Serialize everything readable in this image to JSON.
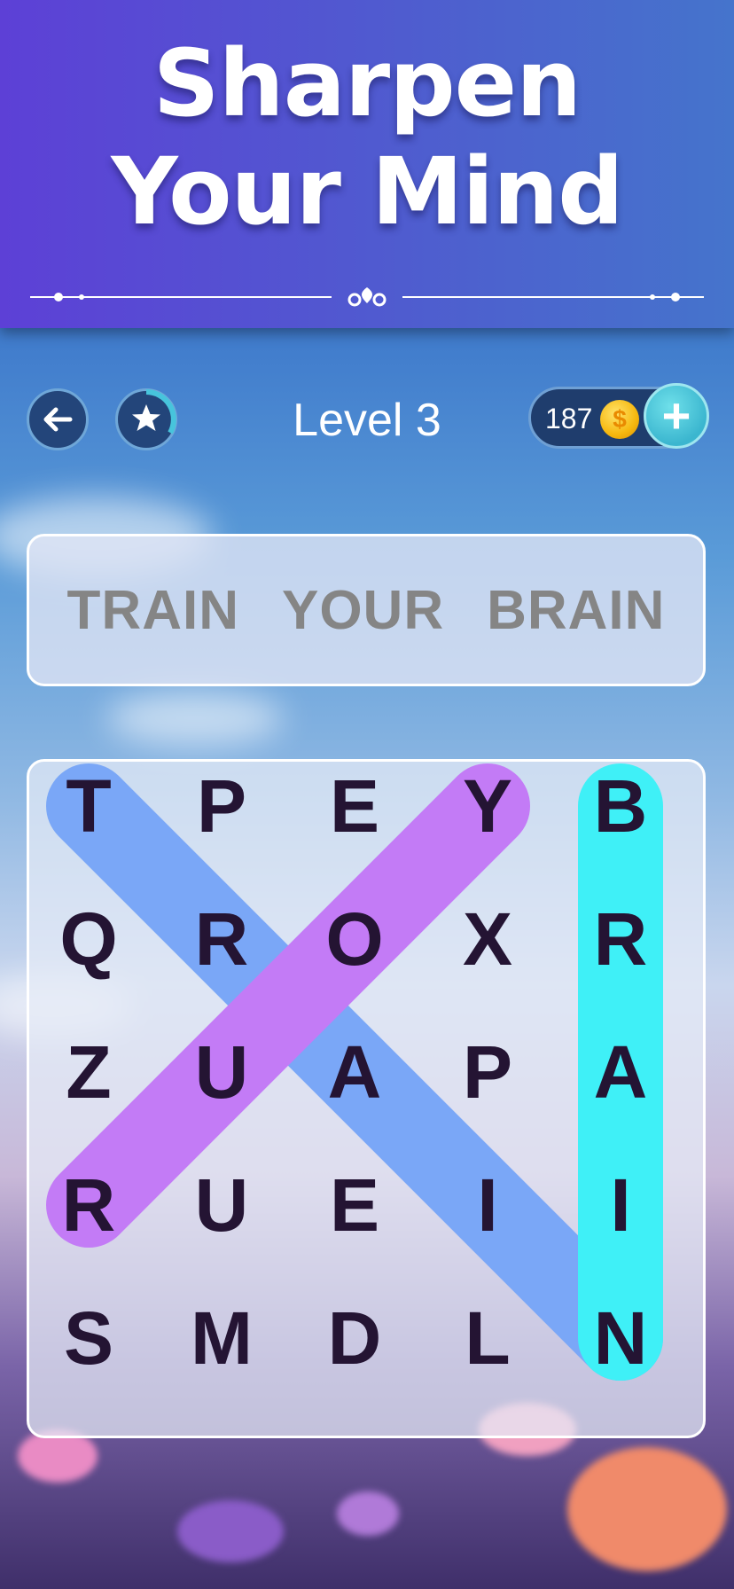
{
  "banner": {
    "line1": "Sharpen",
    "line2": "Your Mind"
  },
  "topbar": {
    "back_icon": "arrow-left-icon",
    "star_icon": "star-icon",
    "level_label": "Level 3",
    "coins": "187",
    "coin_icon": "coin-dollar-icon",
    "coin_symbol": "$",
    "plus_label": "+"
  },
  "words": [
    "TRAIN",
    "YOUR",
    "BRAIN"
  ],
  "grid": [
    [
      "T",
      "P",
      "E",
      "Y",
      "B"
    ],
    [
      "Q",
      "R",
      "O",
      "X",
      "R"
    ],
    [
      "Z",
      "U",
      "A",
      "P",
      "A"
    ],
    [
      "R",
      "U",
      "E",
      "I",
      "I"
    ],
    [
      "S",
      "M",
      "D",
      "L",
      "N"
    ]
  ],
  "found_words": [
    {
      "word": "TRAIN",
      "from": [
        0,
        0
      ],
      "to": [
        4,
        4
      ],
      "color": "#7aa7f7"
    },
    {
      "word": "YOUR",
      "from": [
        0,
        3
      ],
      "to": [
        3,
        0
      ],
      "color": "#c37bf6"
    },
    {
      "word": "BRAIN",
      "from": [
        0,
        4
      ],
      "to": [
        4,
        4
      ],
      "color": "#3ff0f7"
    }
  ],
  "colors": {
    "banner": "#5d40d6",
    "letter": "#241433",
    "word_text": "#858585"
  }
}
